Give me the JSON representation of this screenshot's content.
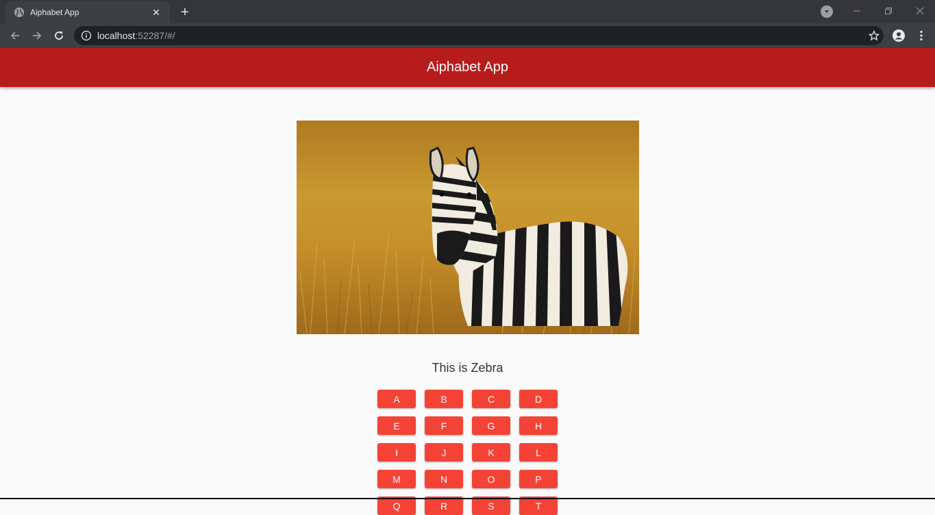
{
  "browser": {
    "tab_title": "Aiphabet App",
    "new_tab_symbol": "+",
    "close_tab_symbol": "✕",
    "url_host": "localhost",
    "url_rest": ":52287/#/"
  },
  "app": {
    "title": "Aiphabet App",
    "caption": "This is Zebra",
    "image_subject": "zebra",
    "letters": [
      "A",
      "B",
      "C",
      "D",
      "E",
      "F",
      "G",
      "H",
      "I",
      "J",
      "K",
      "L",
      "M",
      "N",
      "O",
      "P",
      "Q",
      "R",
      "S",
      "T"
    ]
  },
  "colors": {
    "appbar": "#b71c1c",
    "button": "#f44336",
    "background": "#fafafa"
  }
}
